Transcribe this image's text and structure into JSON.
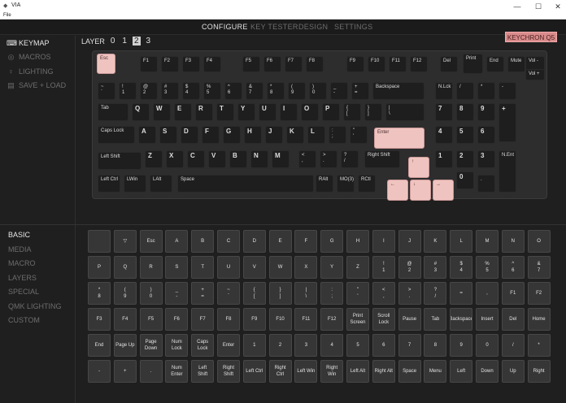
{
  "window": {
    "title": "VIA",
    "menu_file": "File",
    "min": "—",
    "max": "☐",
    "close": "✕"
  },
  "nav": [
    "CONFIGURE",
    "KEY TESTER",
    "DESIGN",
    "SETTINGS"
  ],
  "sidebar": {
    "items": [
      {
        "label": "KEYMAP",
        "icon": "keyboard-icon"
      },
      {
        "label": "MACROS",
        "icon": "macro-icon"
      },
      {
        "label": "LIGHTING",
        "icon": "lightbulb-icon"
      },
      {
        "label": "SAVE + LOAD",
        "icon": "save-icon"
      }
    ]
  },
  "categories": [
    "BASIC",
    "MEDIA",
    "MACRO",
    "LAYERS",
    "SPECIAL",
    "QMK LIGHTING",
    "CUSTOM"
  ],
  "layer": {
    "label": "LAYER",
    "numbers": [
      "0",
      "1",
      "2",
      "3"
    ],
    "active": 2
  },
  "keyboard_name": "KEYCHRON Q5",
  "keys": [
    {
      "t": "Esc",
      "acc": 1
    },
    {
      "t": "F1"
    },
    {
      "t": "F2"
    },
    {
      "t": "F3"
    },
    {
      "t": "F4"
    },
    {
      "t": "F5"
    },
    {
      "t": "F6"
    },
    {
      "t": "F7"
    },
    {
      "t": "F8"
    },
    {
      "t": "F9"
    },
    {
      "t": "F10"
    },
    {
      "t": "F11"
    },
    {
      "t": "F12"
    },
    {
      "t": "Del"
    },
    {
      "t": "Print"
    },
    {
      "t": "End"
    },
    {
      "t": "Mute"
    },
    {
      "t": "Vol -"
    },
    {
      "t": "Vol +"
    },
    {
      "t": "~\n`"
    },
    {
      "t": "!\n1"
    },
    {
      "t": "@\n2"
    },
    {
      "t": "#\n3"
    },
    {
      "t": "$\n4"
    },
    {
      "t": "%\n5"
    },
    {
      "t": "^\n6"
    },
    {
      "t": "&\n7"
    },
    {
      "t": "*\n8"
    },
    {
      "t": "(\n9"
    },
    {
      "t": ")\n0"
    },
    {
      "t": "_\n-"
    },
    {
      "t": "+\n="
    },
    {
      "t": "Backspace"
    },
    {
      "t": "N.Lck"
    },
    {
      "t": "/"
    },
    {
      "t": "*"
    },
    {
      "t": "-"
    },
    {
      "t": "Tab"
    },
    {
      "t": "Q",
      "b": 1
    },
    {
      "t": "W",
      "b": 1
    },
    {
      "t": "E",
      "b": 1
    },
    {
      "t": "R",
      "b": 1
    },
    {
      "t": "T",
      "b": 1
    },
    {
      "t": "Y",
      "b": 1
    },
    {
      "t": "U",
      "b": 1
    },
    {
      "t": "I",
      "b": 1
    },
    {
      "t": "O",
      "b": 1
    },
    {
      "t": "P",
      "b": 1
    },
    {
      "t": "{\n["
    },
    {
      "t": "}\n]"
    },
    {
      "t": "|\n\\"
    },
    {
      "t": "7",
      "b": 1
    },
    {
      "t": "8",
      "b": 1
    },
    {
      "t": "9",
      "b": 1
    },
    {
      "t": "+",
      "b": 1
    },
    {
      "t": "Caps Lock"
    },
    {
      "t": "A",
      "b": 1
    },
    {
      "t": "S",
      "b": 1
    },
    {
      "t": "D",
      "b": 1
    },
    {
      "t": "F",
      "b": 1
    },
    {
      "t": "G",
      "b": 1
    },
    {
      "t": "H",
      "b": 1
    },
    {
      "t": "J",
      "b": 1
    },
    {
      "t": "K",
      "b": 1
    },
    {
      "t": "L",
      "b": 1
    },
    {
      "t": ":\n;"
    },
    {
      "t": "\"\n'"
    },
    {
      "t": "Enter",
      "acc": 1
    },
    {
      "t": "4",
      "b": 1
    },
    {
      "t": "5",
      "b": 1
    },
    {
      "t": "6",
      "b": 1
    },
    {
      "t": "Left Shift"
    },
    {
      "t": "Z",
      "b": 1
    },
    {
      "t": "X",
      "b": 1
    },
    {
      "t": "C",
      "b": 1
    },
    {
      "t": "V",
      "b": 1
    },
    {
      "t": "B",
      "b": 1
    },
    {
      "t": "N",
      "b": 1
    },
    {
      "t": "M",
      "b": 1
    },
    {
      "t": "<\n,"
    },
    {
      "t": ">\n."
    },
    {
      "t": "?\n/"
    },
    {
      "t": "Right Shift"
    },
    {
      "t": "↑",
      "acc": 1
    },
    {
      "t": "1",
      "b": 1
    },
    {
      "t": "2",
      "b": 1
    },
    {
      "t": "3",
      "b": 1
    },
    {
      "t": "N.Ent"
    },
    {
      "t": "Left Ctrl"
    },
    {
      "t": "LWin"
    },
    {
      "t": "LAlt"
    },
    {
      "t": "Space"
    },
    {
      "t": "RAlt"
    },
    {
      "t": "MO(3)"
    },
    {
      "t": "RCtl"
    },
    {
      "t": "←",
      "acc": 1
    },
    {
      "t": "↓",
      "acc": 1
    },
    {
      "t": "→",
      "acc": 1
    },
    {
      "t": "0",
      "b": 1
    },
    {
      "t": "."
    }
  ],
  "keycodes": [
    "",
    "▽",
    "Esc",
    "A",
    "B",
    "C",
    "D",
    "E",
    "F",
    "G",
    "H",
    "I",
    "J",
    "K",
    "L",
    "M",
    "N",
    "O",
    "P",
    "Q",
    "R",
    "S",
    "T",
    "U",
    "V",
    "W",
    "X",
    "Y",
    "Z",
    "!\n1",
    "@\n2",
    "#\n3",
    "$\n4",
    "%\n5",
    "^\n6",
    "&\n7",
    "*\n8",
    "(\n9",
    ")\n0",
    "_\n-",
    "+\n=",
    "~\n`",
    "{\n[",
    "}\n]",
    "|\n\\",
    ":\n;",
    "\"\n'",
    "<\n,",
    ">\n.",
    "?\n/",
    "=",
    ",",
    "F1",
    "F2",
    "F3",
    "F4",
    "F5",
    "F6",
    "F7",
    "F8",
    "F9",
    "F10",
    "F11",
    "F12",
    "Print\nScreen",
    "Scroll\nLock",
    "Pause",
    "Tab",
    "Backspace",
    "Insert",
    "Del",
    "Home",
    "End",
    "Page Up",
    "Page\nDown",
    "Num\nLock",
    "Caps\nLock",
    "Enter",
    "1",
    "2",
    "3",
    "4",
    "5",
    "6",
    "7",
    "8",
    "9",
    "0",
    "/",
    "*",
    "-",
    "+",
    ".",
    "Num\nEnter",
    "Left\nShift",
    "Right\nShift",
    "Left Ctrl",
    "Right\nCtrl",
    "Left Win",
    "Right\nWin",
    "Left Alt",
    "Right Alt",
    "Space",
    "Menu",
    "Left",
    "Down",
    "Up",
    "Right"
  ]
}
